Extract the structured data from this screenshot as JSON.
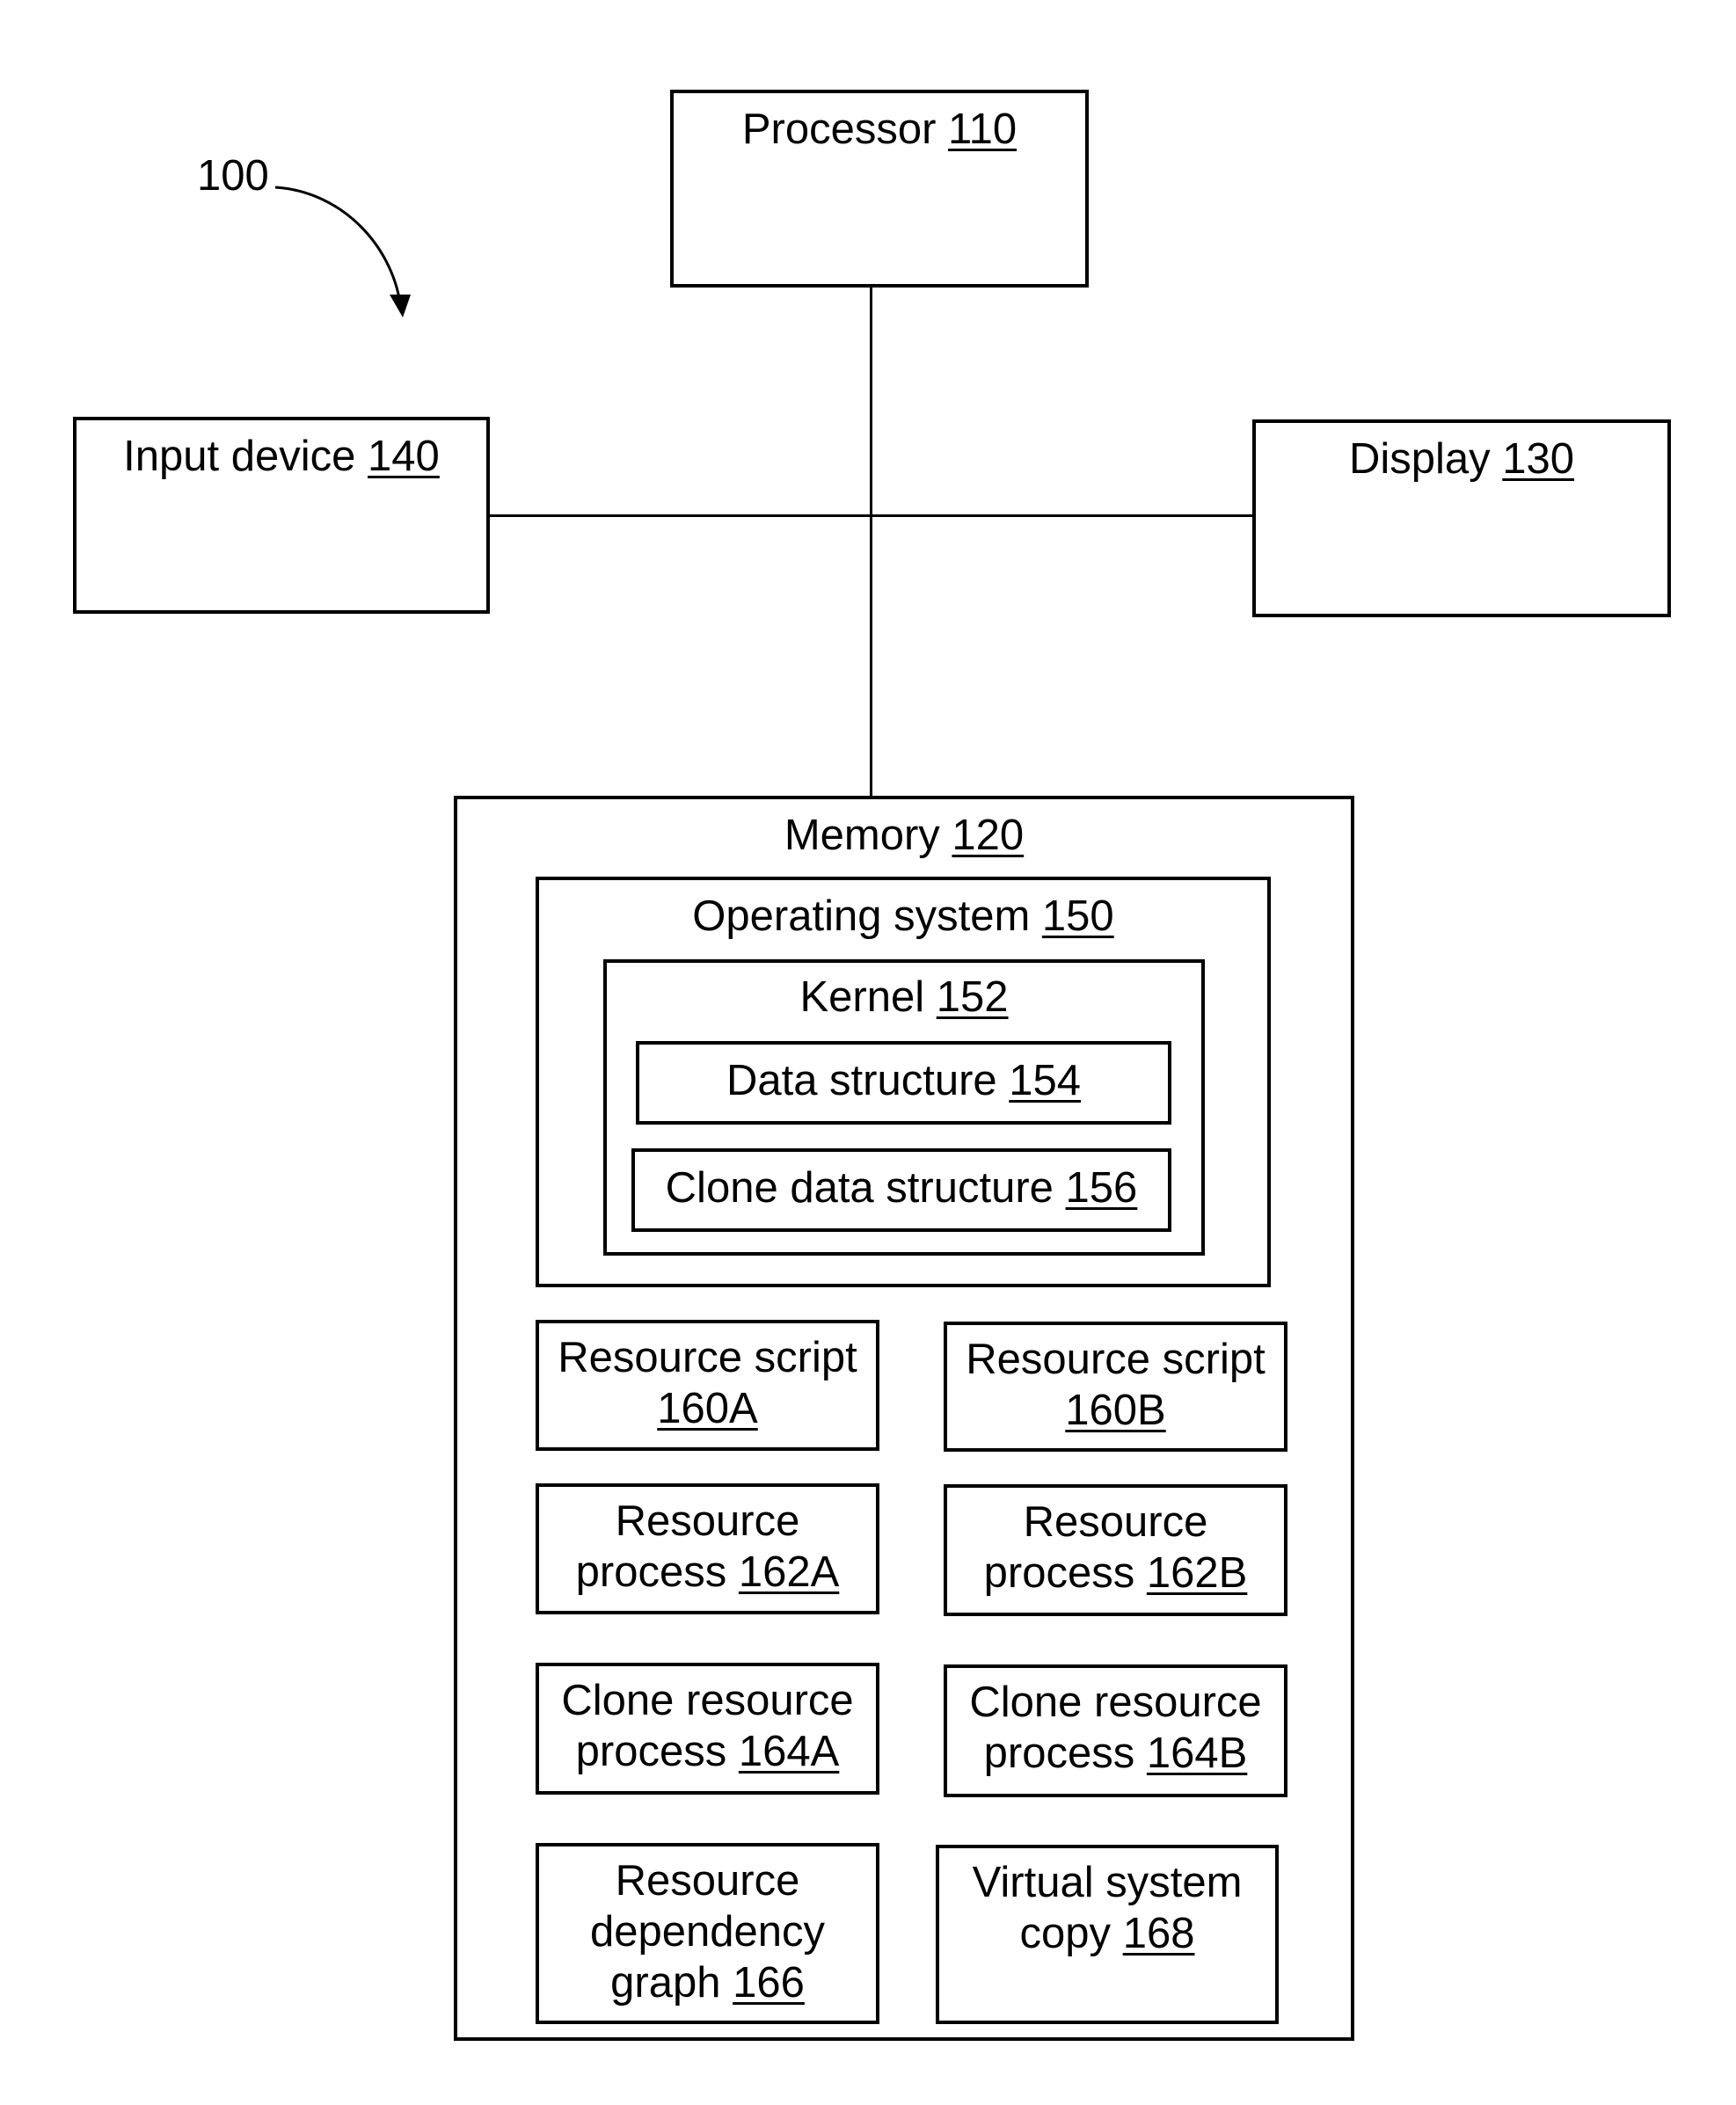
{
  "figure": {
    "ref_label": "100"
  },
  "processor": {
    "name": "Processor",
    "ref": "110"
  },
  "input_device": {
    "name": "Input device",
    "ref": "140"
  },
  "display": {
    "name": "Display",
    "ref": "130"
  },
  "memory": {
    "name": "Memory",
    "ref": "120",
    "os": {
      "name": "Operating system",
      "ref": "150",
      "kernel": {
        "name": "Kernel",
        "ref": "152",
        "data_structure": {
          "name": "Data structure",
          "ref": "154"
        },
        "clone_data_structure": {
          "name": "Clone data structure",
          "ref": "156"
        }
      }
    },
    "resource_script_a": {
      "line1": "Resource script",
      "line2": "",
      "ref": "160A"
    },
    "resource_script_b": {
      "line1": "Resource script",
      "line2": "",
      "ref": "160B"
    },
    "resource_process_a": {
      "line1": "Resource",
      "line2": "process",
      "ref": "162A"
    },
    "resource_process_b": {
      "line1": "Resource",
      "line2": "process",
      "ref": "162B"
    },
    "clone_process_a": {
      "line1": "Clone resource",
      "line2": "process",
      "ref": "164A"
    },
    "clone_process_b": {
      "line1": "Clone resource",
      "line2": "process",
      "ref": "164B"
    },
    "dependency_graph": {
      "line1": "Resource",
      "line2": "dependency",
      "line3": "graph",
      "ref": "166"
    },
    "virtual_copy": {
      "line1": "Virtual system",
      "line2": "copy",
      "ref": "168"
    }
  }
}
